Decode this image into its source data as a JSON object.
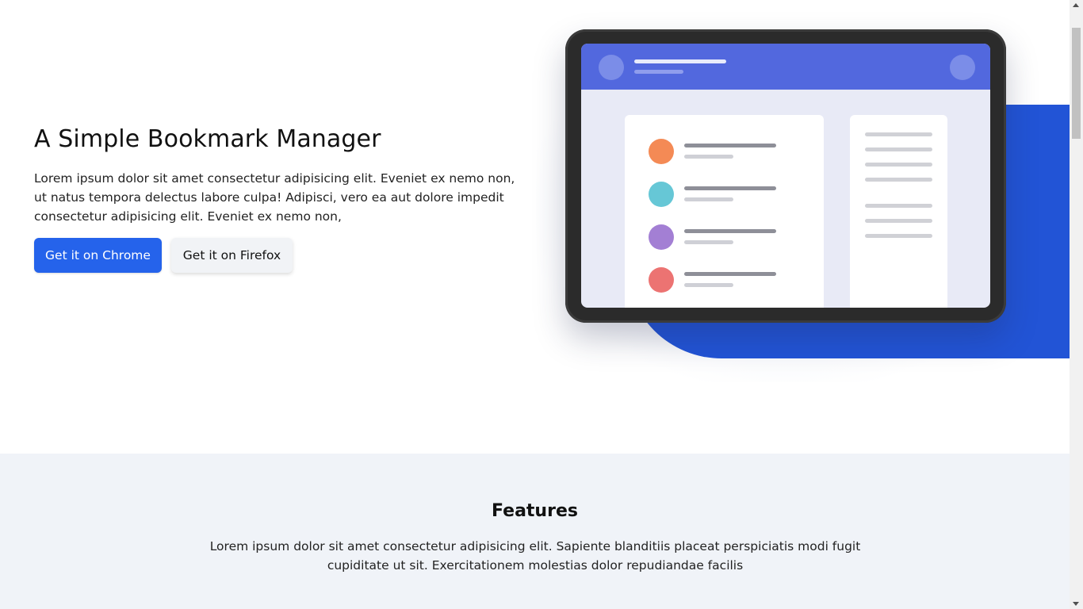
{
  "hero": {
    "title": "A Simple Bookmark Manager",
    "description": "Lorem ipsum dolor sit amet consectetur adipisicing elit. Eveniet ex nemo non, ut natus tempora delectus labore culpa! Adipisci, vero ea aut dolore impedit consectetur adipisicing elit. Eveniet ex nemo non,",
    "chrome_button": "Get it on Chrome",
    "firefox_button": "Get it on Firefox"
  },
  "illustration": {
    "icon": "tablet-bookmark-illustration",
    "list_dot_colors": [
      "#f48a55",
      "#66c7d6",
      "#a37fd4",
      "#ec7372"
    ],
    "accent_color": "#2254d6",
    "header_color": "#5268de"
  },
  "features": {
    "title": "Features",
    "description": "Lorem ipsum dolor sit amet consectetur adipisicing elit. Sapiente blanditiis placeat perspiciatis modi fugit cupiditate ut sit. Exercitationem molestias dolor repudiandae facilis"
  },
  "colors": {
    "primary": "#2563eb",
    "secondary_button": "#f1f3f6",
    "features_bg": "#f0f3f8"
  }
}
